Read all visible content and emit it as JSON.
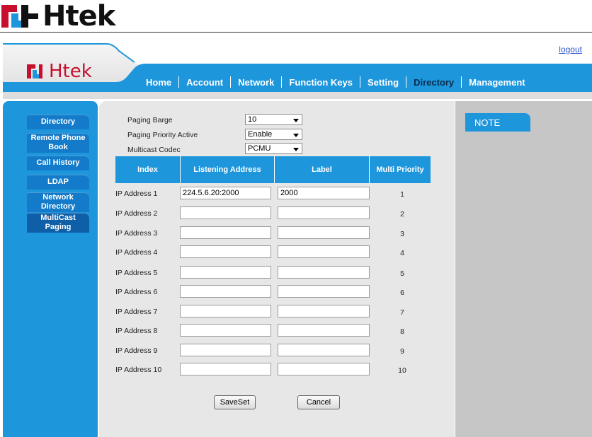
{
  "header": {
    "logout_label": "logout",
    "logo_text": "Htek",
    "nav": [
      {
        "label": "Home",
        "active": false
      },
      {
        "label": "Account",
        "active": false
      },
      {
        "label": "Network",
        "active": false
      },
      {
        "label": "Function Keys",
        "active": false
      },
      {
        "label": "Setting",
        "active": false
      },
      {
        "label": "Directory",
        "active": true
      },
      {
        "label": "Management",
        "active": false
      }
    ]
  },
  "sidebar": {
    "items": [
      {
        "label": "Directory"
      },
      {
        "label": "Remote Phone Book"
      },
      {
        "label": "Call History"
      },
      {
        "label": "LDAP"
      },
      {
        "label": "Network Directory"
      },
      {
        "label": "MultiCast Paging"
      }
    ]
  },
  "form": {
    "paging_barge": {
      "label": "Paging Barge",
      "value": "10"
    },
    "paging_priority": {
      "label": "Paging Priority Active",
      "value": "Enable"
    },
    "multicast_codec": {
      "label": "Multicast Codec",
      "value": "PCMU"
    }
  },
  "table": {
    "headers": [
      "Index",
      "Listening Address",
      "Label",
      "Multi Priority"
    ],
    "rows": [
      {
        "label": "IP Address 1",
        "address": "224.5.6.20:2000",
        "name": "2000",
        "priority": "1"
      },
      {
        "label": "IP Address 2",
        "address": "",
        "name": "",
        "priority": "2"
      },
      {
        "label": "IP Address 3",
        "address": "",
        "name": "",
        "priority": "3"
      },
      {
        "label": "IP Address 4",
        "address": "",
        "name": "",
        "priority": "4"
      },
      {
        "label": "IP Address 5",
        "address": "",
        "name": "",
        "priority": "5"
      },
      {
        "label": "IP Address 6",
        "address": "",
        "name": "",
        "priority": "6"
      },
      {
        "label": "IP Address 7",
        "address": "",
        "name": "",
        "priority": "7"
      },
      {
        "label": "IP Address 8",
        "address": "",
        "name": "",
        "priority": "8"
      },
      {
        "label": "IP Address 9",
        "address": "",
        "name": "",
        "priority": "9"
      },
      {
        "label": "IP Address 10",
        "address": "",
        "name": "",
        "priority": "10"
      }
    ]
  },
  "buttons": {
    "save_label": "SaveSet",
    "cancel_label": "Cancel"
  },
  "note": {
    "title": "NOTE"
  },
  "colors": {
    "brand_blue": "#1e96dc",
    "logo_red": "#c8102e",
    "link_blue": "#2a55c9"
  }
}
